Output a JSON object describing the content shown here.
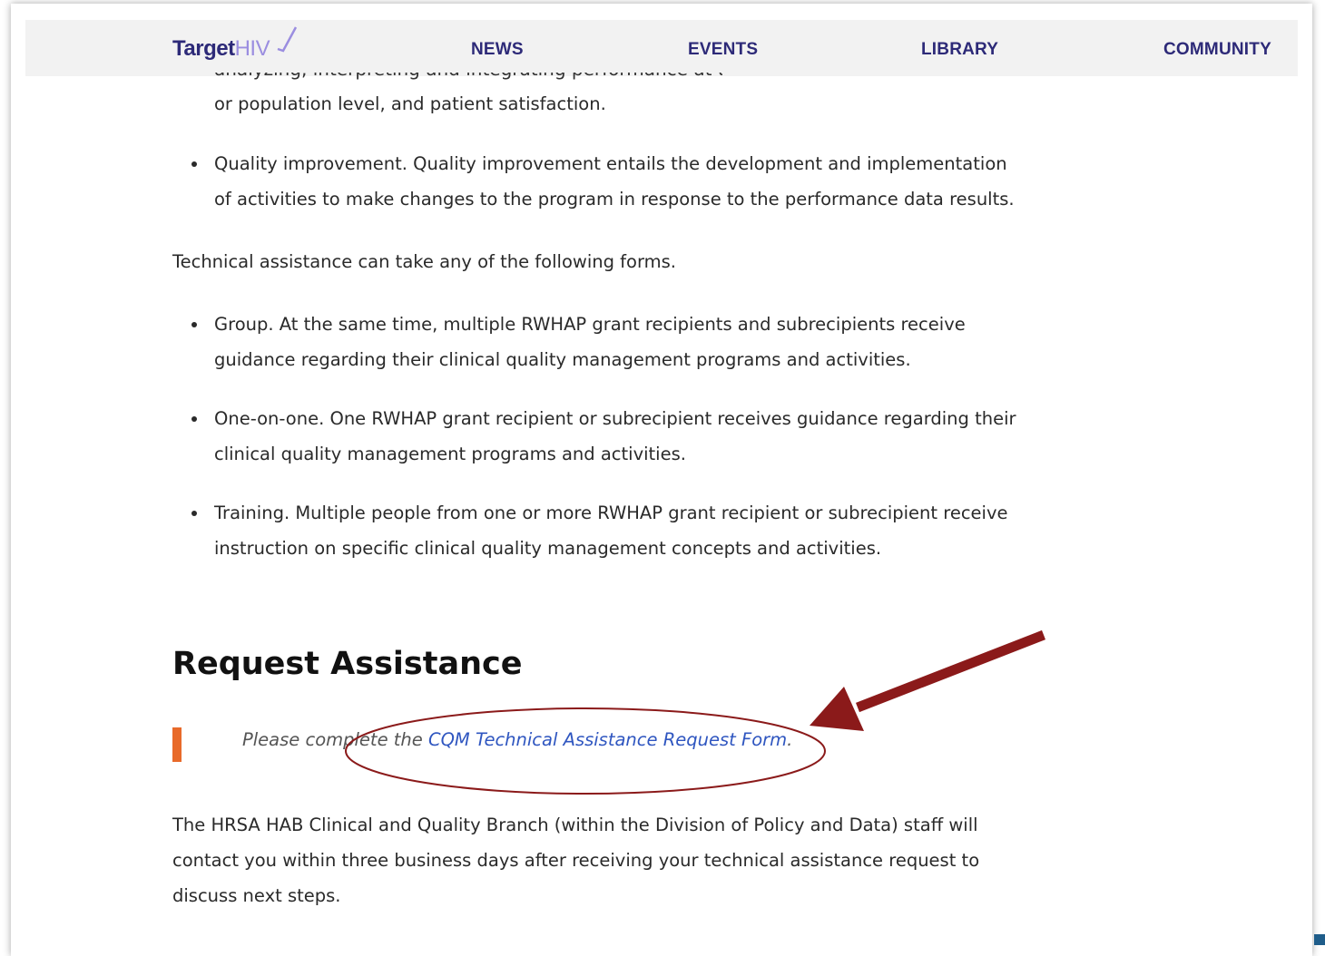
{
  "nav": {
    "logo_part1": "Target",
    "logo_part2": "HIV",
    "items": [
      "NEWS",
      "EVENTS",
      "LIBRARY",
      "COMMUNITY"
    ]
  },
  "content": {
    "cutoff_line": "analyzing, interpreting and integrating performance at the provider, program",
    "para1_end": "or population level, and patient satisfaction.",
    "bullet_quality": "Quality improvement. Quality improvement entails the development and implementation of activities to make changes to the program in response to the performance data results.",
    "forms_intro": "Technical assistance can take any of the following forms.",
    "forms": [
      "Group. At the same time, multiple RWHAP grant recipients and subrecipients receive guidance regarding their clinical quality management programs and activities.",
      "One-on-one. One RWHAP grant recipient or subrecipient receives guidance regarding their clinical quality management programs and activities.",
      "Training. Multiple people from one or more RWHAP grant recipient or subrecipient receive instruction on specific clinical quality management concepts and activities."
    ],
    "heading": "Request Assistance",
    "quote_prefix": "Please complete the ",
    "quote_link": "CQM Technical Assistance Request Form",
    "quote_suffix": ".",
    "closing": "The HRSA HAB Clinical and Quality Branch (within the Division of Policy and Data) staff will contact you within three business days after receiving your technical assistance request to discuss next steps."
  },
  "colors": {
    "brand": "#2d2a78",
    "link": "#2f56c0",
    "accent": "#e86a2a",
    "annotation": "#8b1a1a"
  }
}
